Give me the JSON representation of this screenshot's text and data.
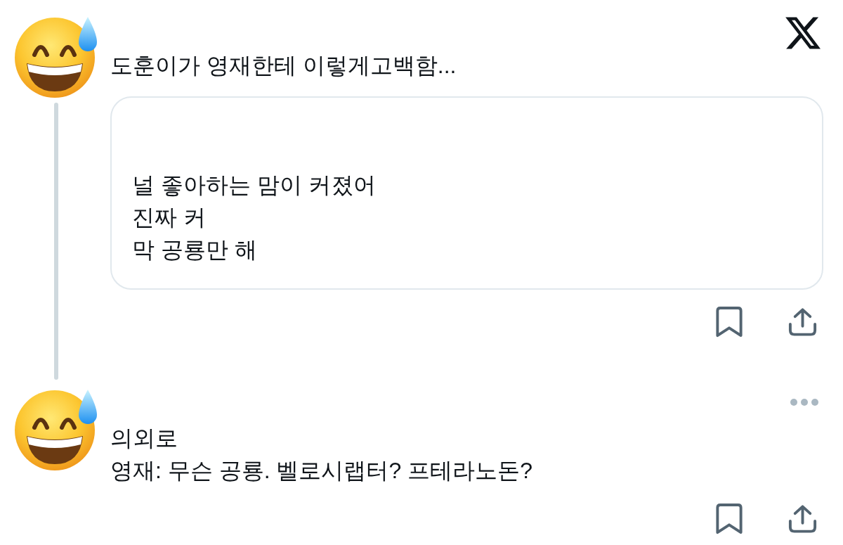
{
  "posts": [
    {
      "lines": [
        "도훈이가 영재한테 이렇게고백함..."
      ],
      "thread_line": true,
      "more_menu": false,
      "quote": {
        "lines": [
          "널 좋아하는 맘이 커졌어",
          "진짜 커",
          "막 공룡만 해"
        ]
      }
    },
    {
      "lines": [
        "의외로",
        "영재: 무슨 공룡. 벨로시랩터? 프테라노돈?"
      ],
      "thread_line": false,
      "more_menu": true
    }
  ]
}
